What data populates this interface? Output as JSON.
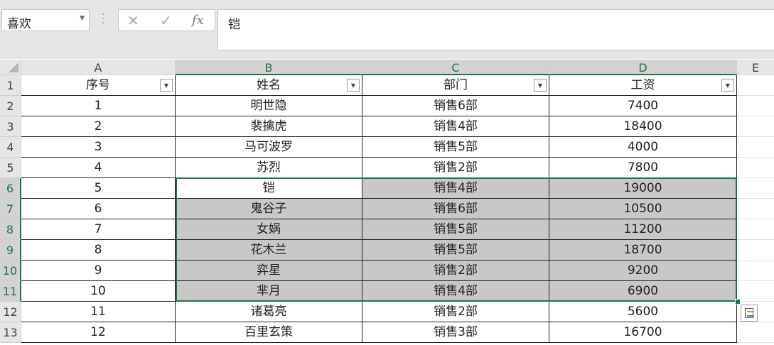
{
  "name_box": {
    "value": "喜欢"
  },
  "formula_bar": {
    "cancel_symbol": "✕",
    "enter_symbol": "✓",
    "fx_label": "fx",
    "content": "铠"
  },
  "columns": [
    "A",
    "B",
    "C",
    "D",
    "E"
  ],
  "header_row": [
    "序号",
    "姓名",
    "部门",
    "工资"
  ],
  "rows": [
    [
      "1",
      "明世隐",
      "销售6部",
      "7400"
    ],
    [
      "2",
      "裴擒虎",
      "销售4部",
      "18400"
    ],
    [
      "3",
      "马可波罗",
      "销售5部",
      "4000"
    ],
    [
      "4",
      "苏烈",
      "销售2部",
      "7800"
    ],
    [
      "5",
      "铠",
      "销售4部",
      "19000"
    ],
    [
      "6",
      "鬼谷子",
      "销售6部",
      "10500"
    ],
    [
      "7",
      "女娲",
      "销售5部",
      "11200"
    ],
    [
      "8",
      "花木兰",
      "销售5部",
      "18700"
    ],
    [
      "9",
      "弈星",
      "销售2部",
      "9200"
    ],
    [
      "10",
      "芈月",
      "销售4部",
      "6900"
    ],
    [
      "11",
      "诸葛亮",
      "销售2部",
      "5600"
    ],
    [
      "12",
      "百里玄策",
      "销售3部",
      "16700"
    ]
  ],
  "row_numbers": [
    "1",
    "2",
    "3",
    "4",
    "5",
    "6",
    "7",
    "8",
    "9",
    "10",
    "11",
    "12",
    "13"
  ],
  "selection": {
    "range": "B6:D11",
    "active_cell": "B6"
  },
  "colors": {
    "accent": "#217346",
    "selection_fill": "#c8c8c8",
    "header_bg": "#e6e6e6"
  }
}
